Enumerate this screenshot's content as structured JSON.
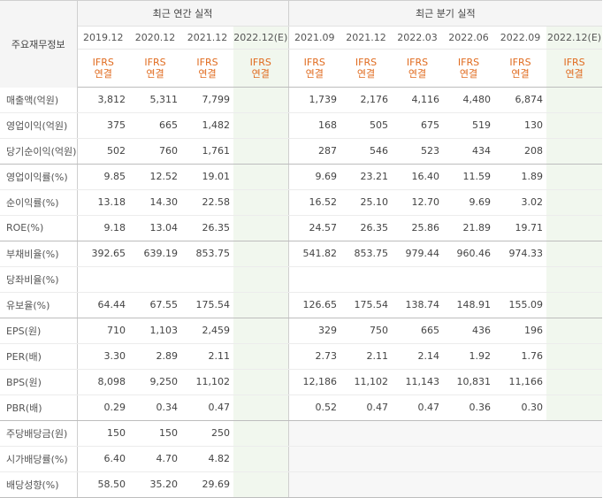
{
  "header": {
    "corner_label": "주요재무정보",
    "annual_group": "최근 연간 실적",
    "quarterly_group": "최근 분기 실적",
    "annual_periods": [
      "2019.12",
      "2020.12",
      "2021.12",
      "2022.12(E)"
    ],
    "quarterly_periods": [
      "2021.09",
      "2021.12",
      "2022.03",
      "2022.06",
      "2022.09",
      "2022.12(E)"
    ],
    "accounting_line1": "IFRS",
    "accounting_line2": "연결"
  },
  "rows": [
    {
      "label": "매출액(억원)",
      "annual": [
        "3,812",
        "5,311",
        "7,799",
        ""
      ],
      "quarterly": [
        "1,739",
        "2,176",
        "4,116",
        "4,480",
        "6,874",
        ""
      ]
    },
    {
      "label": "영업이익(억원)",
      "annual": [
        "375",
        "665",
        "1,482",
        ""
      ],
      "quarterly": [
        "168",
        "505",
        "675",
        "519",
        "130",
        ""
      ]
    },
    {
      "label": "당기순이익(억원)",
      "annual": [
        "502",
        "760",
        "1,761",
        ""
      ],
      "quarterly": [
        "287",
        "546",
        "523",
        "434",
        "208",
        ""
      ]
    },
    {
      "label": "영업이익률(%)",
      "annual": [
        "9.85",
        "12.52",
        "19.01",
        ""
      ],
      "quarterly": [
        "9.69",
        "23.21",
        "16.40",
        "11.59",
        "1.89",
        ""
      ]
    },
    {
      "label": "순이익률(%)",
      "annual": [
        "13.18",
        "14.30",
        "22.58",
        ""
      ],
      "quarterly": [
        "16.52",
        "25.10",
        "12.70",
        "9.69",
        "3.02",
        ""
      ]
    },
    {
      "label": "ROE(%)",
      "annual": [
        "9.18",
        "13.04",
        "26.35",
        ""
      ],
      "quarterly": [
        "24.57",
        "26.35",
        "25.86",
        "21.89",
        "19.71",
        ""
      ]
    },
    {
      "label": "부채비율(%)",
      "annual": [
        "392.65",
        "639.19",
        "853.75",
        ""
      ],
      "quarterly": [
        "541.82",
        "853.75",
        "979.44",
        "960.46",
        "974.33",
        ""
      ]
    },
    {
      "label": "당좌비율(%)",
      "annual": [
        "",
        "",
        "",
        ""
      ],
      "quarterly": [
        "",
        "",
        "",
        "",
        "",
        ""
      ]
    },
    {
      "label": "유보율(%)",
      "annual": [
        "64.44",
        "67.55",
        "175.54",
        ""
      ],
      "quarterly": [
        "126.65",
        "175.54",
        "138.74",
        "148.91",
        "155.09",
        ""
      ]
    },
    {
      "label": "EPS(원)",
      "annual": [
        "710",
        "1,103",
        "2,459",
        ""
      ],
      "quarterly": [
        "329",
        "750",
        "665",
        "436",
        "196",
        ""
      ]
    },
    {
      "label": "PER(배)",
      "annual": [
        "3.30",
        "2.89",
        "2.11",
        ""
      ],
      "quarterly": [
        "2.73",
        "2.11",
        "2.14",
        "1.92",
        "1.76",
        ""
      ]
    },
    {
      "label": "BPS(원)",
      "annual": [
        "8,098",
        "9,250",
        "11,102",
        ""
      ],
      "quarterly": [
        "12,186",
        "11,102",
        "11,143",
        "10,831",
        "11,166",
        ""
      ]
    },
    {
      "label": "PBR(배)",
      "annual": [
        "0.29",
        "0.34",
        "0.47",
        ""
      ],
      "quarterly": [
        "0.52",
        "0.47",
        "0.47",
        "0.36",
        "0.30",
        ""
      ]
    },
    {
      "label": "주당배당금(원)",
      "annual": [
        "150",
        "150",
        "250",
        ""
      ],
      "quarterly": [
        "",
        "",
        "",
        "",
        "",
        ""
      ]
    },
    {
      "label": "시가배당률(%)",
      "annual": [
        "6.40",
        "4.70",
        "4.82",
        ""
      ],
      "quarterly": [
        "",
        "",
        "",
        "",
        "",
        ""
      ]
    },
    {
      "label": "배당성향(%)",
      "annual": [
        "58.50",
        "35.20",
        "29.69",
        ""
      ],
      "quarterly": [
        "",
        "",
        "",
        "",
        "",
        ""
      ]
    }
  ],
  "colors": {
    "accent": "#e06b1f",
    "estimate_bg": "#f1f7ee",
    "header_bg": "#f5f5f5"
  }
}
